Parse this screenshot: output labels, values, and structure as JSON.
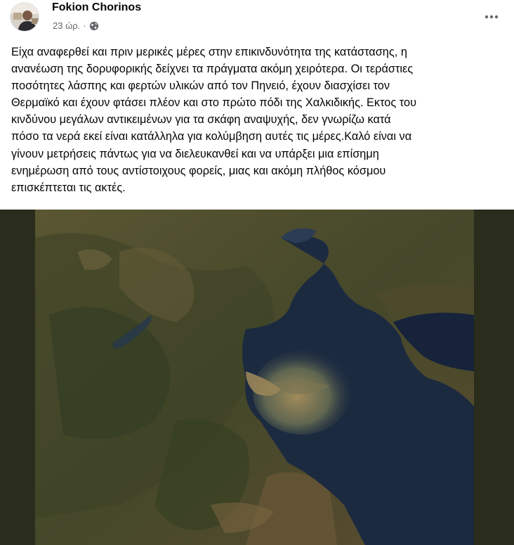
{
  "post": {
    "author_name": "Fokion Chorinos",
    "timestamp": "23 ώρ.",
    "separator": "·",
    "audience_icon": "globe-icon",
    "more_icon": "more-options-icon",
    "text": "Είχα αναφερθεί και πριν μερικές μέρες στην επικινδυνότητα της κατάστασης, η\nανανέωση της δορυφορικής δείχνει τα πράγματα ακόμη χειρότερα. Οι τεράστιες\nποσότητες λάσπης και φερτών υλικών από τον Πηνειό, έχουν διασχίσει τον\nΘερμαϊκό και έχουν φτάσει πλέον και στο πρώτο πόδι της Χαλκιδικής. Εκτος του\nκινδύνου μεγάλων αντικειμένων για τα σκάφη αναψυχής, δεν γνωρίζω κατά\nπόσο τα νερά εκεί είναι κατάλληλα για κολύμβηση αυτές τις μέρες.Καλό είναι να\nγίνουν μετρήσεις πάντως για να διελευκανθεί και να υπάρξει μια επίσημη\nενημέρωση από τους αντίστοιχους φορείς, μιας και ακόμη πλήθος κόσμου\nεπισκέπτεται τις ακτές.",
    "media": {
      "kind": "satellite-image",
      "frame_color": "#2a2c1c",
      "sea_color": "#1c2a40",
      "land_color": "#4a4a2c",
      "sediment_color": "#8a7a52"
    }
  }
}
